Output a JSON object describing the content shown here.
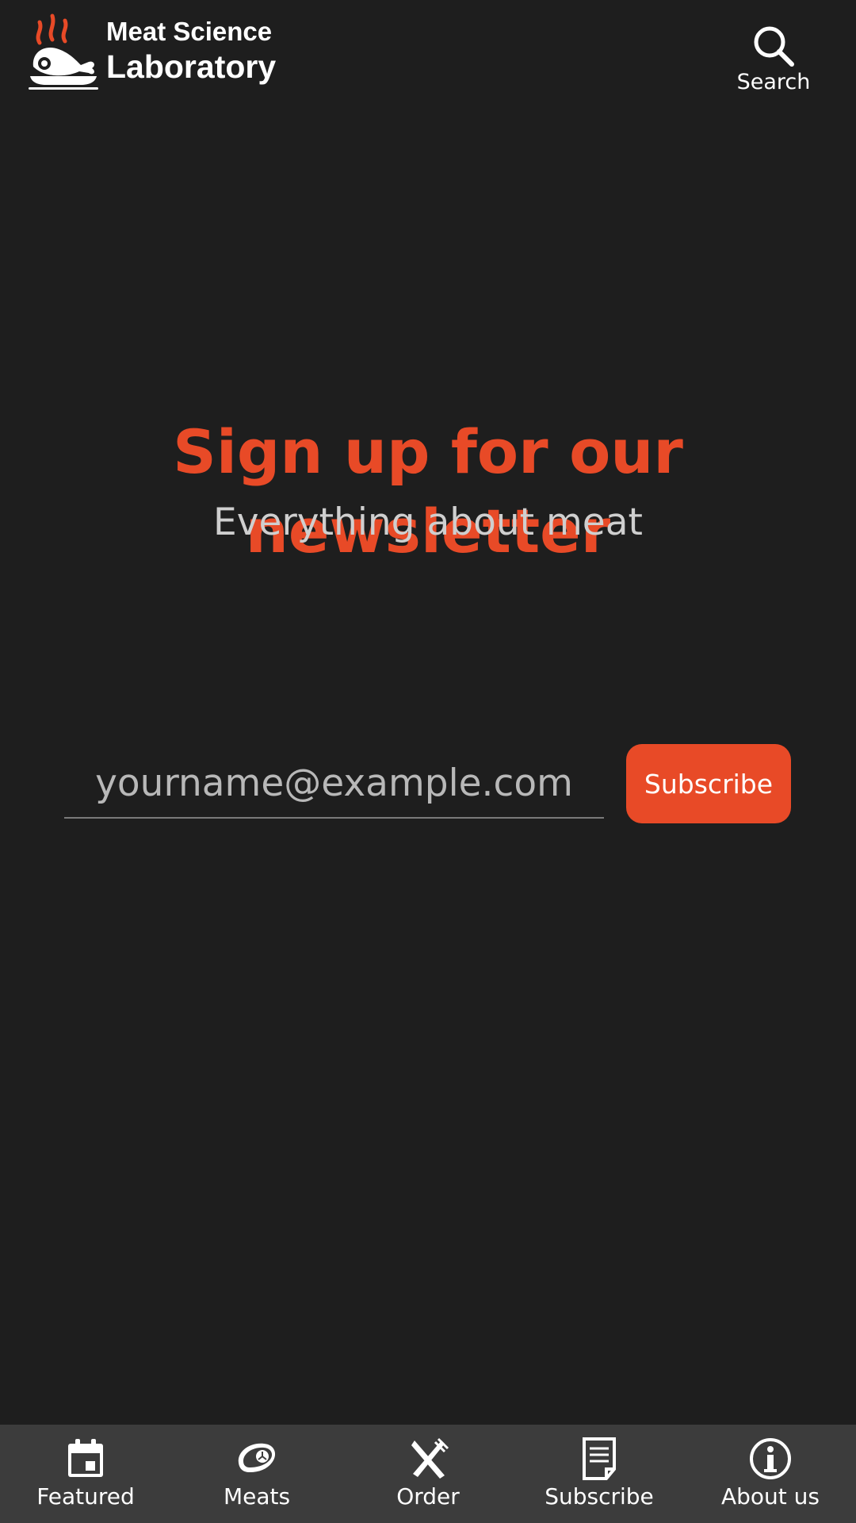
{
  "header": {
    "logo_line1": "Meat Science",
    "logo_line2": "Laboratory",
    "search_label": "Search"
  },
  "hero": {
    "title": "Sign up for our newsletter",
    "subtitle": "Everything about meat"
  },
  "form": {
    "email_placeholder": "yourname@example.com",
    "email_value": "",
    "subscribe_label": "Subscribe"
  },
  "bottom_nav": {
    "items": [
      {
        "label": "Featured",
        "icon": "calendar-icon"
      },
      {
        "label": "Meats",
        "icon": "steak-icon"
      },
      {
        "label": "Order",
        "icon": "fork-knife-icon"
      },
      {
        "label": "Subscribe",
        "icon": "document-icon"
      },
      {
        "label": "About us",
        "icon": "info-icon"
      }
    ]
  },
  "colors": {
    "background": "#1e1e1e",
    "accent": "#e84a27",
    "nav_background": "#3c3c3c",
    "text": "#ffffff",
    "subtitle_text": "#cfcfcf"
  }
}
